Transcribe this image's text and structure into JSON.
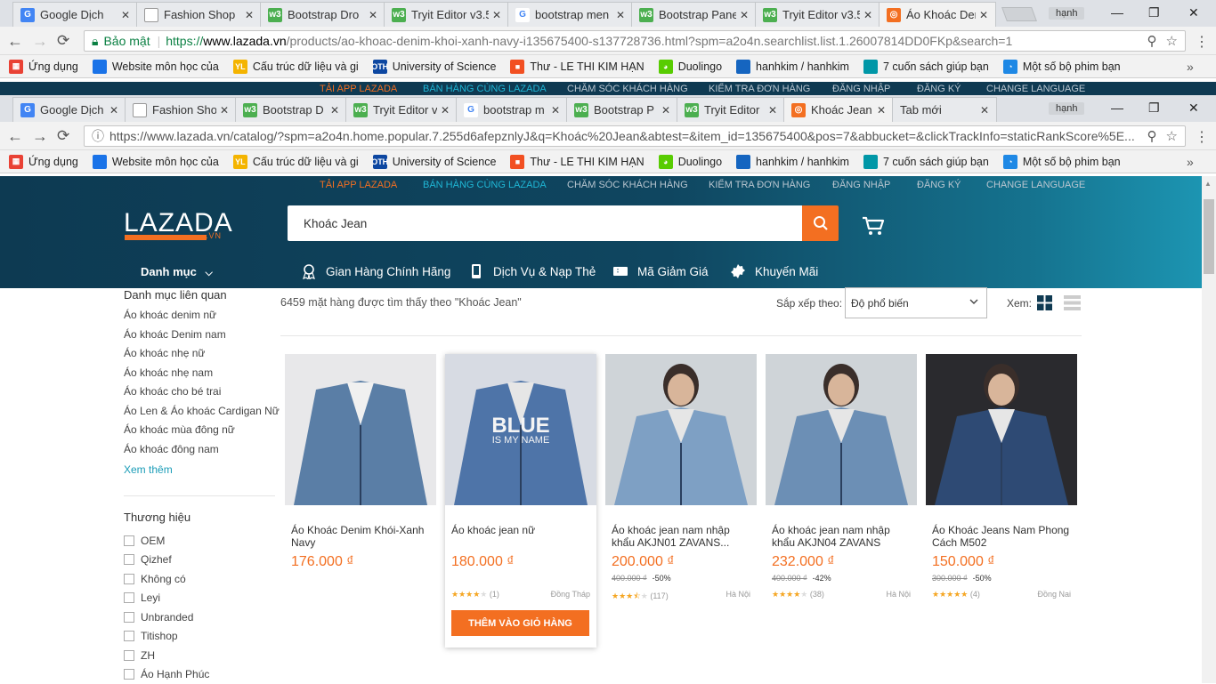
{
  "browser1": {
    "tabs": [
      {
        "label": "Google Dịch",
        "icon": "google-translate-icon",
        "color": "#4285f4"
      },
      {
        "label": "Fashion Shop",
        "icon": "page-icon",
        "color": "#ffffff"
      },
      {
        "label": "Bootstrap Dro",
        "icon": "w3schools-icon",
        "color": "#4caf50"
      },
      {
        "label": "Tryit Editor v3.5",
        "icon": "w3schools-icon",
        "color": "#4caf50"
      },
      {
        "label": "bootstrap men",
        "icon": "google-icon",
        "color": "#ffffff"
      },
      {
        "label": "Bootstrap Pane",
        "icon": "w3schools-icon",
        "color": "#4caf50"
      },
      {
        "label": "Tryit Editor v3.5",
        "icon": "w3schools-icon",
        "color": "#4caf50"
      },
      {
        "label": "Áo Khoác Den",
        "icon": "lazada-icon",
        "color": "#f36f21"
      }
    ],
    "profile": "hạnh",
    "secure_label": "Bảo mật",
    "url_scheme": "https://",
    "url_host": "www.lazada.vn",
    "url_path": "/products/ao-khoac-denim-khoi-xanh-navy-i135675400-s137728736.html?spm=a2o4n.searchlist.list.1.26007814DD0FKp&search=1"
  },
  "browser2": {
    "tabs": [
      {
        "label": "Google Dịch",
        "icon": "google-translate-icon",
        "color": "#4285f4"
      },
      {
        "label": "Fashion Sho",
        "icon": "page-icon",
        "color": "#ffffff"
      },
      {
        "label": "Bootstrap D",
        "icon": "w3schools-icon",
        "color": "#4caf50"
      },
      {
        "label": "Tryit Editor v",
        "icon": "w3schools-icon",
        "color": "#4caf50"
      },
      {
        "label": "bootstrap m",
        "icon": "google-icon",
        "color": "#ffffff"
      },
      {
        "label": "Bootstrap P",
        "icon": "w3schools-icon",
        "color": "#4caf50"
      },
      {
        "label": "Tryit Editor",
        "icon": "w3schools-icon",
        "color": "#4caf50"
      },
      {
        "label": "Khoác Jean",
        "icon": "lazada-icon",
        "color": "#f36f21"
      },
      {
        "label": "Tab mới",
        "icon": "none",
        "color": "#ffffff"
      }
    ],
    "profile": "hạnh",
    "url": "https://www.lazada.vn/catalog/?spm=a2o4n.home.popular.7.255d6afepznlyJ&q=Khoác%20Jean&abtest=&item_id=135675400&pos=7&abbucket=&clickTrackInfo=staticRankScore%5E..."
  },
  "bookmarks": [
    {
      "label": "Ứng dụng",
      "icon": "apps-grid-icon",
      "color": "#e94235"
    },
    {
      "label": "Website môn học của",
      "icon": "moodle-icon",
      "color": "#1a73e8"
    },
    {
      "label": "Cấu trúc dữ liệu và gi",
      "icon": "yl-icon",
      "color": "#f4b400"
    },
    {
      "label": "University of Science",
      "icon": "hcmus-icon",
      "color": "#0d47a1"
    },
    {
      "label": "Thư - LE THI KIM HẠN",
      "icon": "microsoft-icon",
      "color": "#f25022"
    },
    {
      "label": "Duolingo",
      "icon": "duolingo-icon",
      "color": "#58cc02"
    },
    {
      "label": "hanhkim / hanhkim",
      "icon": "shield-icon",
      "color": "#1565c0"
    },
    {
      "label": "7 cuốn sách giúp bạn",
      "icon": "wave-icon",
      "color": "#0097a7"
    },
    {
      "label": "Một số bộ phim bạn",
      "icon": "ghost-icon",
      "color": "#1e88e5"
    }
  ],
  "top_links": [
    "Tải app Lazada",
    "Bán hàng cùng Lazada",
    "Chăm sóc khách hàng",
    "Kiểm tra đơn hàng",
    "Đăng nhập",
    "Đăng ký",
    "Change Language"
  ],
  "top_link_colors": [
    "#f36f21",
    "#1fb7d6",
    "#b9c6d0",
    "#b9c6d0",
    "#b9c6d0",
    "#b9c6d0",
    "#b9c6d0"
  ],
  "header": {
    "logo": "LAZADA",
    "logo_suffix": ".VN",
    "search_value": "Khoác Jean",
    "categories_label": "Danh mục",
    "nav": [
      {
        "label": "Gian Hàng Chính Hãng",
        "icon": "medal-icon"
      },
      {
        "label": "Dịch Vụ & Nạp Thẻ",
        "icon": "phone-icon"
      },
      {
        "label": "Mã Giảm Giá",
        "icon": "voucher-icon"
      },
      {
        "label": "Khuyến Mãi",
        "icon": "badge-icon"
      }
    ]
  },
  "sidebar": {
    "related_title": "Danh mục liên quan",
    "related": [
      "Áo khoác denim nữ",
      "Áo khoác Denim nam",
      "Áo khoác nhẹ nữ",
      "Áo khoác nhẹ nam",
      "Áo khoác cho bé trai",
      "Áo Len & Áo khoác Cardigan Nữ",
      "Áo khoác mùa đông nữ",
      "Áo khoác đông nam"
    ],
    "more": "Xem thêm",
    "brand_title": "Thương hiệu",
    "brands": [
      "OEM",
      "Qizhef",
      "Không có",
      "Leyi",
      "Unbranded",
      "Titishop",
      "ZH",
      "Áo Hạnh Phúc"
    ]
  },
  "listing": {
    "result_text": "6459 mặt hàng được tìm thấy theo \"Khoác Jean\"",
    "sort_label": "Sắp xếp theo:",
    "sort_value": "Độ phổ biến",
    "view_label": "Xem:"
  },
  "products": [
    {
      "name": "Áo Khoác Denim Khói-Xanh Navy",
      "price": "176.000 ₫",
      "orig": "",
      "discount": "",
      "rating": 0,
      "reviews": "",
      "location": "",
      "img_color": "#5a7ea6",
      "hover": false
    },
    {
      "name": "Áo khoác jean nữ",
      "price": "180.000 ₫",
      "orig": "",
      "discount": "",
      "rating": 4,
      "reviews": "(1)",
      "location": "Đồng Tháp",
      "img_color": "#4e74a8",
      "hover": true,
      "button": "THÊM VÀO GIỎ HÀNG"
    },
    {
      "name": "Áo khoác jean nam nhập khẩu AKJN01 ZAVANS...",
      "price": "200.000 ₫",
      "orig": "400.000 ₫",
      "discount": "-50%",
      "rating": 3.5,
      "reviews": "(117)",
      "location": "Hà Nội",
      "img_color": "#7ea0c4",
      "hover": false
    },
    {
      "name": "Áo khoác jean nam nhập khẩu AKJN04 ZAVANS (Xan...",
      "price": "232.000 ₫",
      "orig": "400.000 ₫",
      "discount": "-42%",
      "rating": 4,
      "reviews": "(38)",
      "location": "Hà Nội",
      "img_color": "#6c8fb5",
      "hover": false
    },
    {
      "name": "Áo Khoác Jeans Nam Phong Cách M502",
      "price": "150.000 ₫",
      "orig": "300.000 ₫",
      "discount": "-50%",
      "rating": 5,
      "reviews": "(4)",
      "location": "Đồng Nai",
      "img_color": "#2e4a74",
      "hover": false
    }
  ],
  "colors": {
    "brand_orange": "#f36f21",
    "header_dark": "#0f3a52",
    "link_teal": "#1a9cb7"
  }
}
